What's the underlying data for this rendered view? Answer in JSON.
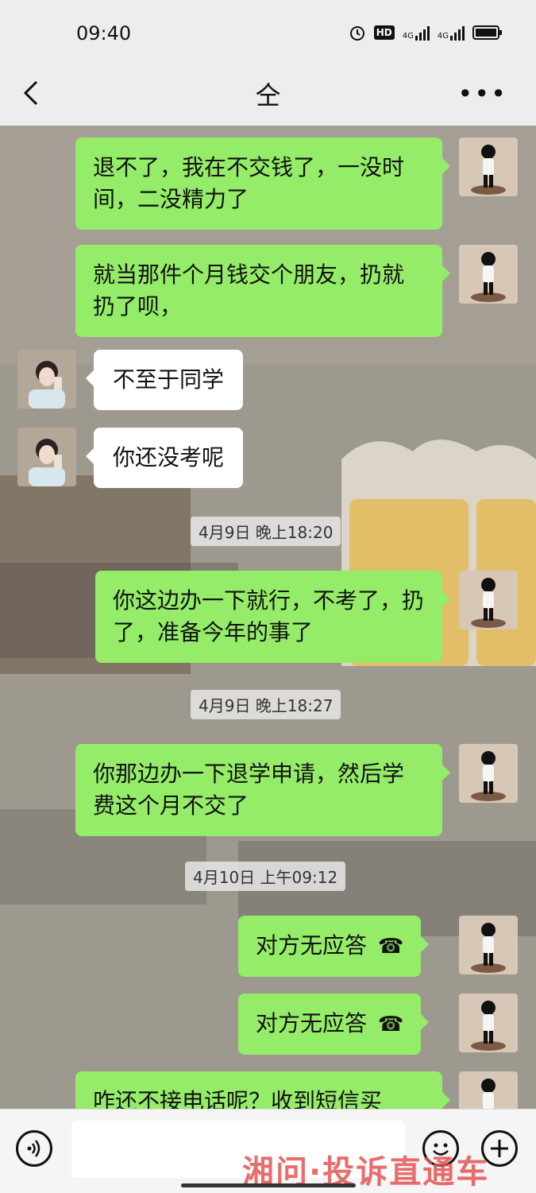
{
  "status_bar": {
    "time": "09:40",
    "hd_label": "HD",
    "network": "4G"
  },
  "nav": {
    "title": "仝"
  },
  "messages": [
    {
      "side": "right",
      "text": "退不了，我在不交钱了，一没时间，二没精力了"
    },
    {
      "side": "right",
      "text": "就当那件个月钱交个朋友，扔就扔了呗，"
    },
    {
      "side": "left",
      "text": "不至于同学"
    },
    {
      "side": "left",
      "text": "你还没考呢"
    },
    {
      "side": "time",
      "text": "4月9日 晚上18:20"
    },
    {
      "side": "right",
      "text": "你这边办一下就行，不考了，扔了，准备今年的事了"
    },
    {
      "side": "time",
      "text": "4月9日 晚上18:27"
    },
    {
      "side": "right",
      "text": "你那边办一下退学申请，然后学费这个月不交了"
    },
    {
      "side": "time",
      "text": "4月10日 上午09:12"
    },
    {
      "side": "right",
      "text": "对方无应答"
    },
    {
      "side": "right",
      "text": "对方无应答"
    },
    {
      "side": "right",
      "text": "咋还不接电话呢？收到短信买"
    }
  ],
  "watermark": "湘问·投诉直通车",
  "colors": {
    "bubble_mine": "#95ec69",
    "bubble_other": "#ffffff",
    "bg": "#ededed"
  }
}
